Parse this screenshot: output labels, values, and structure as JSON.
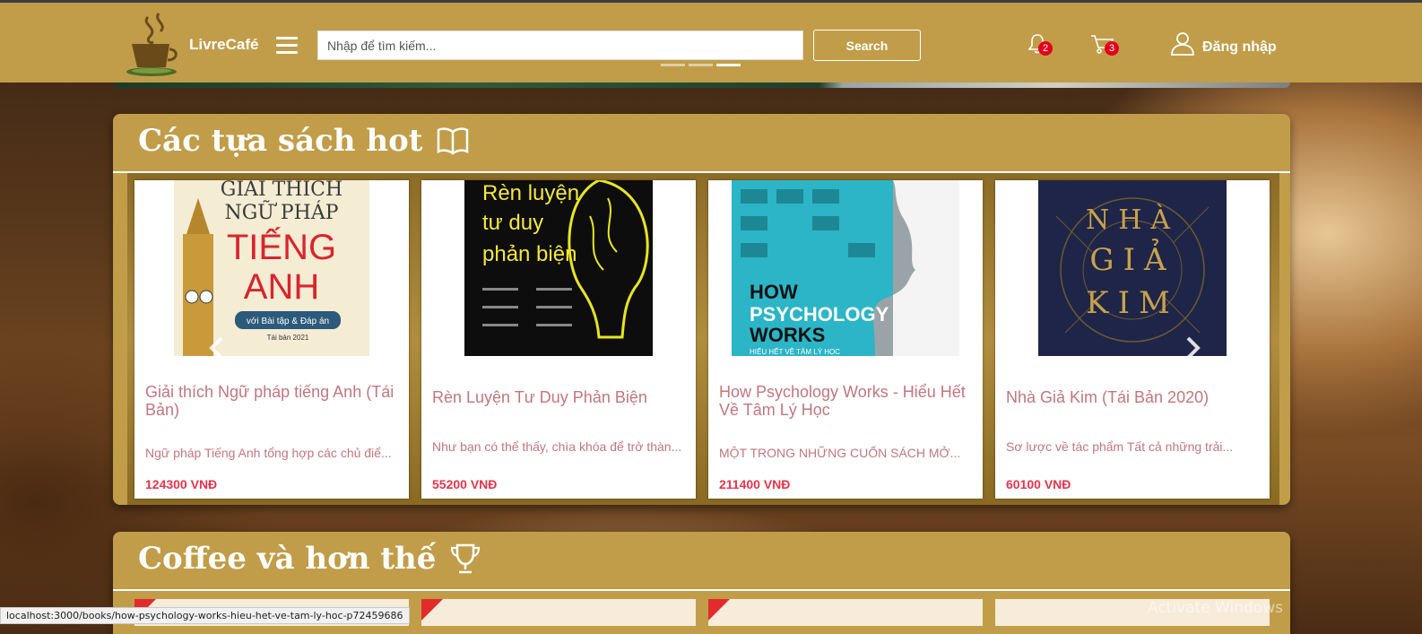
{
  "header": {
    "brand": "LivreCafé",
    "search": {
      "placeholder": "Nhập để tìm kiếm...",
      "button": "Search"
    },
    "notifications": {
      "count": "2"
    },
    "cart": {
      "count": "3"
    },
    "login": "Đăng nhập",
    "carousel_dots": {
      "total": 3,
      "active": 3
    }
  },
  "hot_books": {
    "title": "Các tựa sách hot",
    "books": [
      {
        "title": "Giải thích Ngữ pháp tiếng Anh (Tái Bản)",
        "description": "Ngữ pháp Tiếng Anh tổng hợp các chủ điể...",
        "price": "124300 VNĐ",
        "cover": {
          "line1": "GIẢI THÍCH",
          "line2": "NGỮ PHÁP",
          "line3": "TIẾNG",
          "line4": "ANH",
          "subtitle": "với Bài tập & Đáp án",
          "edition": "Tái bản 2021"
        }
      },
      {
        "title": "Rèn Luyện Tư Duy Phản Biện",
        "description": "Như bạn có thể thấy, chìa khóa để trở thàn...",
        "price": "55200 VNĐ",
        "cover": {
          "line1": "Rèn luyện",
          "line2": "tư duy",
          "line3": "phản biện"
        }
      },
      {
        "title": "How Psychology Works - Hiểu Hết Về Tâm Lý Học",
        "description": "MỘT TRONG NHỮNG CUỐN SÁCH MỞ...",
        "price": "211400 VNĐ",
        "cover": {
          "line1": "HOW",
          "line2": "PSYCHOLOGY",
          "line3": "WORKS",
          "subtitle": "HIỂU HẾT VỀ TÂM LÝ HỌC"
        }
      },
      {
        "title": "Nhà Giả Kim (Tái Bản 2020)",
        "description": "Sơ lược về tác phẩm Tất cả những trải...",
        "price": "60100 VNĐ",
        "cover": {
          "line1": "NHÀ",
          "line2": "GIẢ",
          "line3": "KIM"
        }
      }
    ]
  },
  "coffee": {
    "title": "Coffee và hơn thế"
  },
  "status_url": "localhost:3000/books/how-psychology-works-hieu-het-ve-tam-ly-hoc-p72459686",
  "watermark": {
    "line1": "Activate Windows"
  },
  "colors": {
    "header_bg": "#c19d49",
    "title_text": "#c3767e",
    "price": "#e8334a",
    "badge": "#e3001b"
  },
  "icons": [
    "coffee-logo-icon",
    "hamburger-icon",
    "bell-icon",
    "cart-icon",
    "user-icon",
    "book-open-icon",
    "trophy-icon",
    "chevron-left-icon",
    "chevron-right-icon"
  ]
}
